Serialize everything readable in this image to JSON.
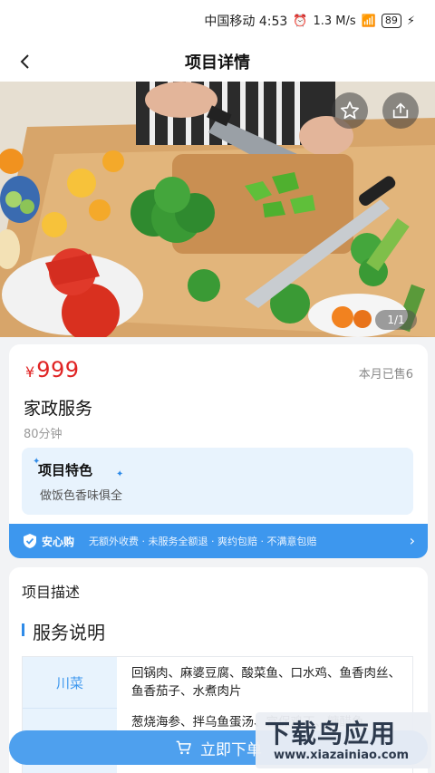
{
  "status_bar": {
    "carrier_time": "中国移动 4:53",
    "net_speed": "1.3 M/s",
    "battery": "89"
  },
  "nav": {
    "title": "项目详情"
  },
  "gallery": {
    "counter": "1/1"
  },
  "product": {
    "price_symbol": "¥",
    "price": "999",
    "sold": "本月已售6",
    "name": "家政服务",
    "duration": "80分钟",
    "feature_title": "项目特色",
    "feature_text": "做饭色香味俱全"
  },
  "assurance": {
    "title": "安心购",
    "text": "无额外收费 · 未服务全额退 · 爽约包赔 · 不满意包赔"
  },
  "description": {
    "header": "项目描述",
    "subheader": "服务说明",
    "rows": [
      {
        "category": "川菜",
        "dishes": "回锅肉、麻婆豆腐、酸菜鱼、口水鸡、鱼香肉丝、鱼香茄子、水煮肉片"
      },
      {
        "category": "",
        "dishes": "葱烧海参、拌乌鱼蛋汤、宫保鸡丁、糖醋鱼"
      }
    ]
  },
  "cta": {
    "label": "立即下单"
  },
  "watermark": {
    "title": "下载鸟应用",
    "url": "www.xiazainiao.com"
  },
  "colors": {
    "accent": "#3d97ee",
    "price": "#e02424"
  }
}
